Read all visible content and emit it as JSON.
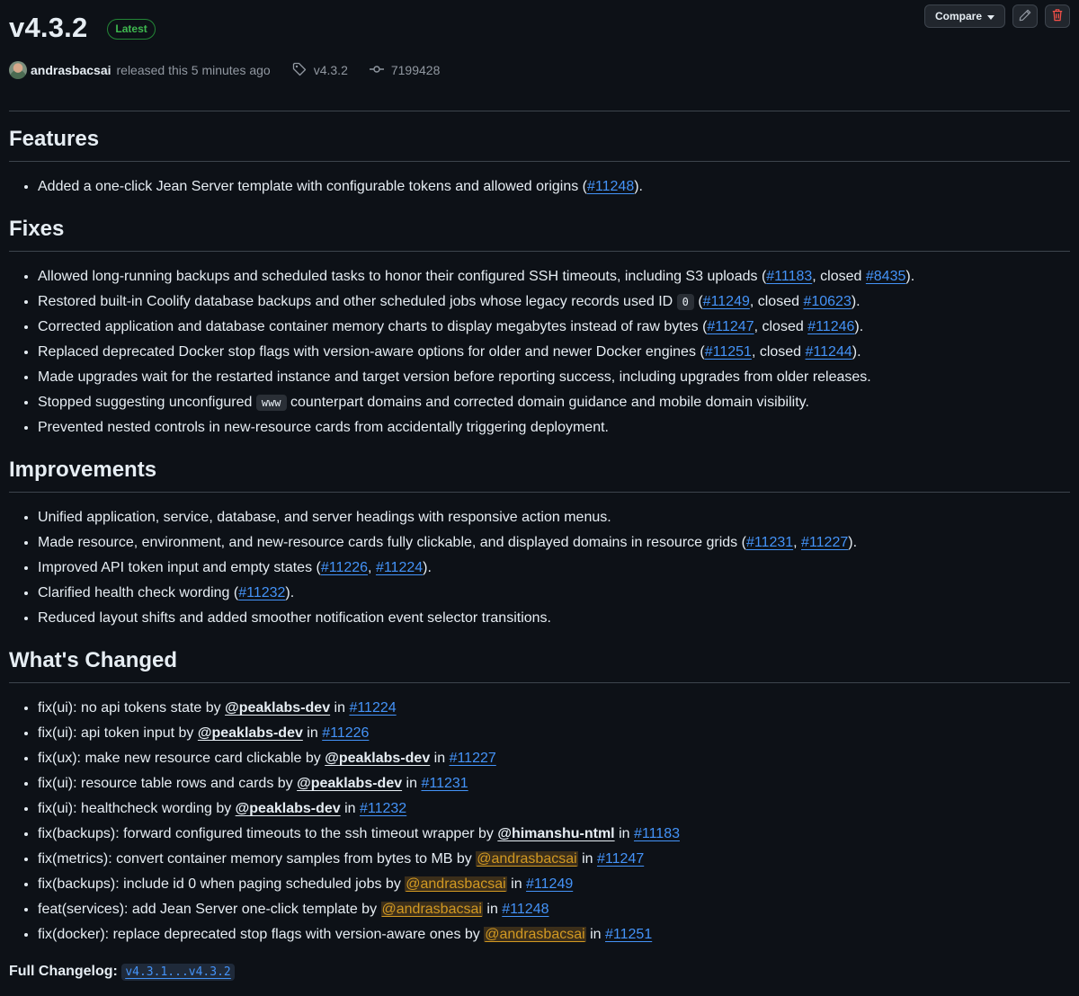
{
  "release": {
    "title": "v4.3.2",
    "badge": "Latest",
    "author": "andrasbacsai",
    "released_text": "released this 5 minutes ago",
    "tag": "v4.3.2",
    "commit": "7199428"
  },
  "toolbar": {
    "compare_label": "Compare"
  },
  "features": {
    "heading": "Features",
    "l1": {
      "text": "Added a one-click Jean Server template with configurable tokens and allowed origins (",
      "pr": "#11248",
      "end": ")."
    }
  },
  "fixes": {
    "heading": "Fixes",
    "l1": {
      "a": "Allowed long-running backups and scheduled tasks to honor their configured SSH timeouts, including S3 uploads (",
      "pr": "#11183",
      "b": ", closed ",
      "issue": "#8435",
      "end": ")."
    },
    "l2": {
      "a": "Restored built-in Coolify database backups and other scheduled jobs whose legacy records used ID ",
      "code": "0",
      "b": " (",
      "pr": "#11249",
      "c": ", closed ",
      "issue": "#10623",
      "end": ")."
    },
    "l3": {
      "a": "Corrected application and database container memory charts to display megabytes instead of raw bytes (",
      "pr": "#11247",
      "b": ", closed ",
      "issue": "#11246",
      "end": ")."
    },
    "l4": {
      "a": "Replaced deprecated Docker stop flags with version-aware options for older and newer Docker engines (",
      "pr": "#11251",
      "b": ", closed ",
      "issue": "#11244",
      "end": ")."
    },
    "l5": {
      "a": "Made upgrades wait for the restarted instance and target version before reporting success, including upgrades from older releases."
    },
    "l6": {
      "a": "Stopped suggesting unconfigured ",
      "code": "www",
      "b": " counterpart domains and corrected domain guidance and mobile domain visibility."
    },
    "l7": {
      "a": "Prevented nested controls in new-resource cards from accidentally triggering deployment."
    }
  },
  "improvements": {
    "heading": "Improvements",
    "l1": {
      "a": "Unified application, service, database, and server headings with responsive action menus."
    },
    "l2": {
      "a": "Made resource, environment, and new-resource cards fully clickable, and displayed domains in resource grids (",
      "pr1": "#11231",
      "sep": ", ",
      "pr2": "#11227",
      "end": ")."
    },
    "l3": {
      "a": "Improved API token input and empty states (",
      "pr1": "#11226",
      "sep": ", ",
      "pr2": "#11224",
      "end": ")."
    },
    "l4": {
      "a": "Clarified health check wording (",
      "pr": "#11232",
      "end": ")."
    },
    "l5": {
      "a": "Reduced layout shifts and added smoother notification event selector transitions."
    }
  },
  "changes": {
    "heading": "What's Changed",
    "by": " by ",
    "in": " in ",
    "items": [
      {
        "text": "fix(ui): no api tokens state",
        "user": "@peaklabs-dev",
        "pr": "#11224"
      },
      {
        "text": "fix(ui): api token input",
        "user": "@peaklabs-dev",
        "pr": "#11226"
      },
      {
        "text": "fix(ux): make new resource card clickable",
        "user": "@peaklabs-dev",
        "pr": "#11227"
      },
      {
        "text": "fix(ui): resource table rows and cards",
        "user": "@peaklabs-dev",
        "pr": "#11231"
      },
      {
        "text": "fix(ui): healthcheck wording",
        "user": "@peaklabs-dev",
        "pr": "#11232"
      },
      {
        "text": "fix(backups): forward configured timeouts to the ssh timeout wrapper",
        "user": "@himanshu-ntml",
        "pr": "#11183"
      },
      {
        "text": "fix(metrics): convert container memory samples from bytes to MB",
        "user": "@andrasbacsai",
        "pr": "#11247"
      },
      {
        "text": "fix(backups): include id 0 when paging scheduled jobs",
        "user": "@andrasbacsai",
        "pr": "#11249"
      },
      {
        "text": "feat(services): add Jean Server one-click template",
        "user": "@andrasbacsai",
        "pr": "#11248"
      },
      {
        "text": "fix(docker): replace deprecated stop flags with version-aware ones",
        "user": "@andrasbacsai",
        "pr": "#11251"
      }
    ]
  },
  "changelog": {
    "label": "Full Changelog:",
    "range": "v4.3.1...v4.3.2"
  },
  "colors": {
    "background": "#0d1117",
    "link": "#4493f8",
    "latest_badge": "#3fb950",
    "self_mention": "#d29922"
  }
}
